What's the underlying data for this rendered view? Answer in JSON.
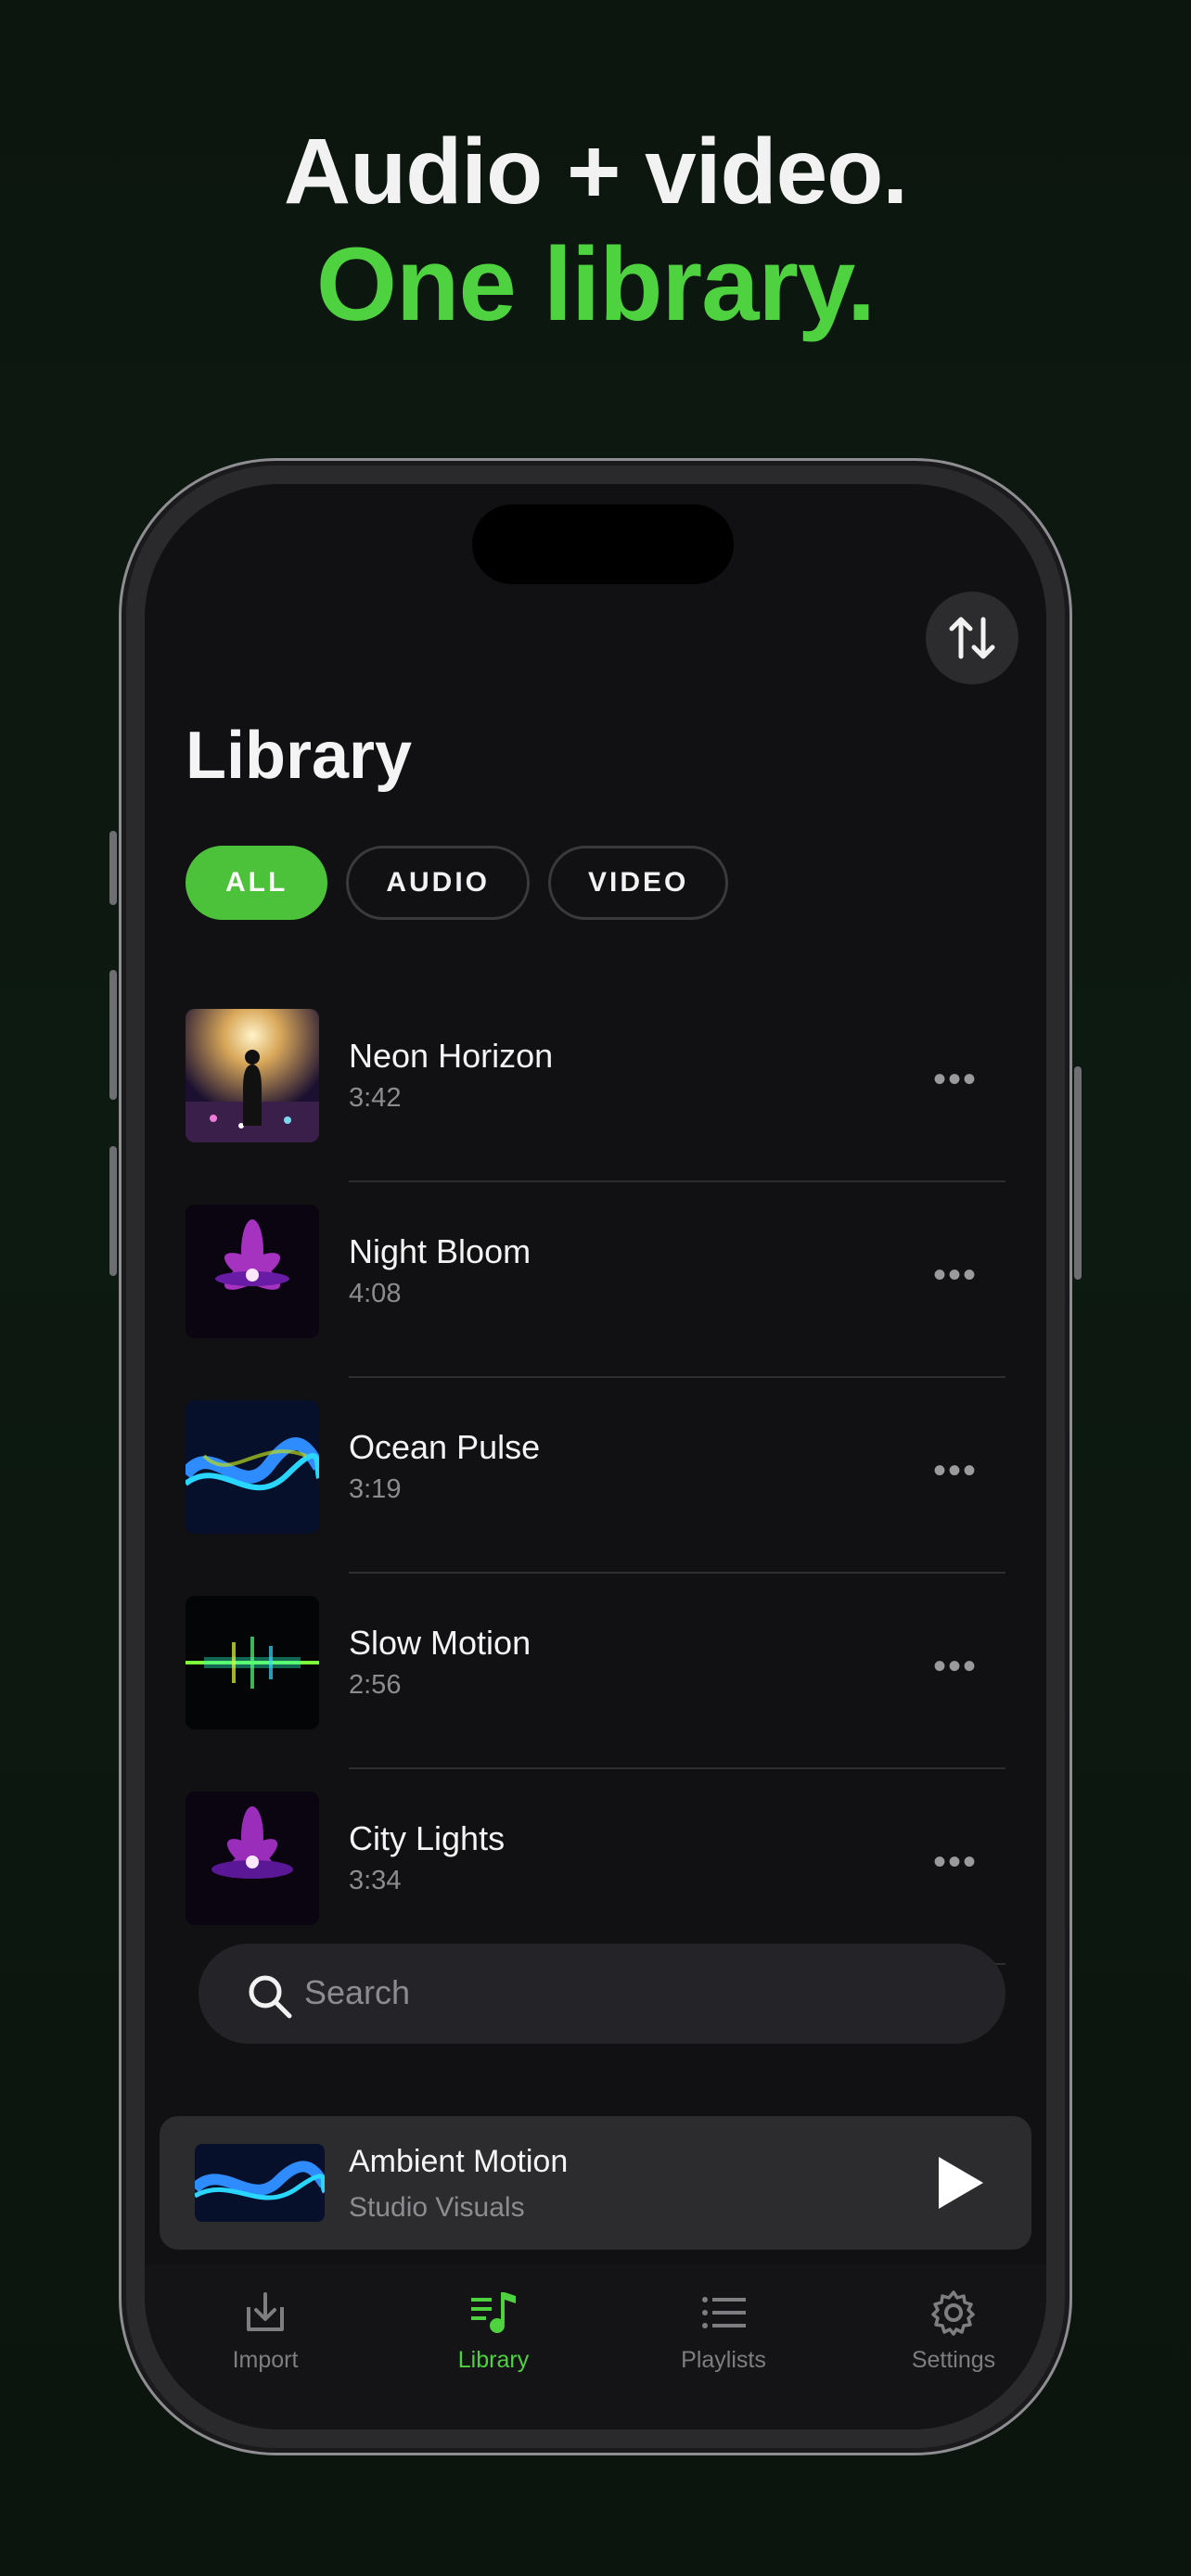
{
  "headline": {
    "line1": "Audio + video.",
    "line2": "One library."
  },
  "colors": {
    "accent": "#4fd23f",
    "background": "#111113",
    "chip_active": "#4cc13a"
  },
  "header": {
    "title": "Library",
    "sort_icon": "sort-arrows-icon"
  },
  "filters": [
    {
      "label": "ALL",
      "active": true
    },
    {
      "label": "AUDIO",
      "active": false
    },
    {
      "label": "VIDEO",
      "active": false
    }
  ],
  "tracks": [
    {
      "title": "Neon Horizon",
      "duration": "3:42",
      "thumb": "concert-stage"
    },
    {
      "title": "Night Bloom",
      "duration": "4:08",
      "thumb": "neon-flower"
    },
    {
      "title": "Ocean Pulse",
      "duration": "3:19",
      "thumb": "blue-waves"
    },
    {
      "title": "Slow Motion",
      "duration": "2:56",
      "thumb": "light-streak"
    },
    {
      "title": "City Lights",
      "duration": "3:34",
      "thumb": "neon-flower"
    }
  ],
  "more_label": "•••",
  "search": {
    "placeholder": "Search",
    "icon": "search-icon"
  },
  "now_playing": {
    "title": "Ambient Motion",
    "subtitle": "Studio Visuals",
    "icon": "play-icon"
  },
  "tabs": [
    {
      "label": "Import",
      "icon": "import-icon",
      "active": false
    },
    {
      "label": "Library",
      "icon": "music-library-icon",
      "active": true
    },
    {
      "label": "Playlists",
      "icon": "list-icon",
      "active": false
    },
    {
      "label": "Settings",
      "icon": "gear-icon",
      "active": false
    }
  ]
}
